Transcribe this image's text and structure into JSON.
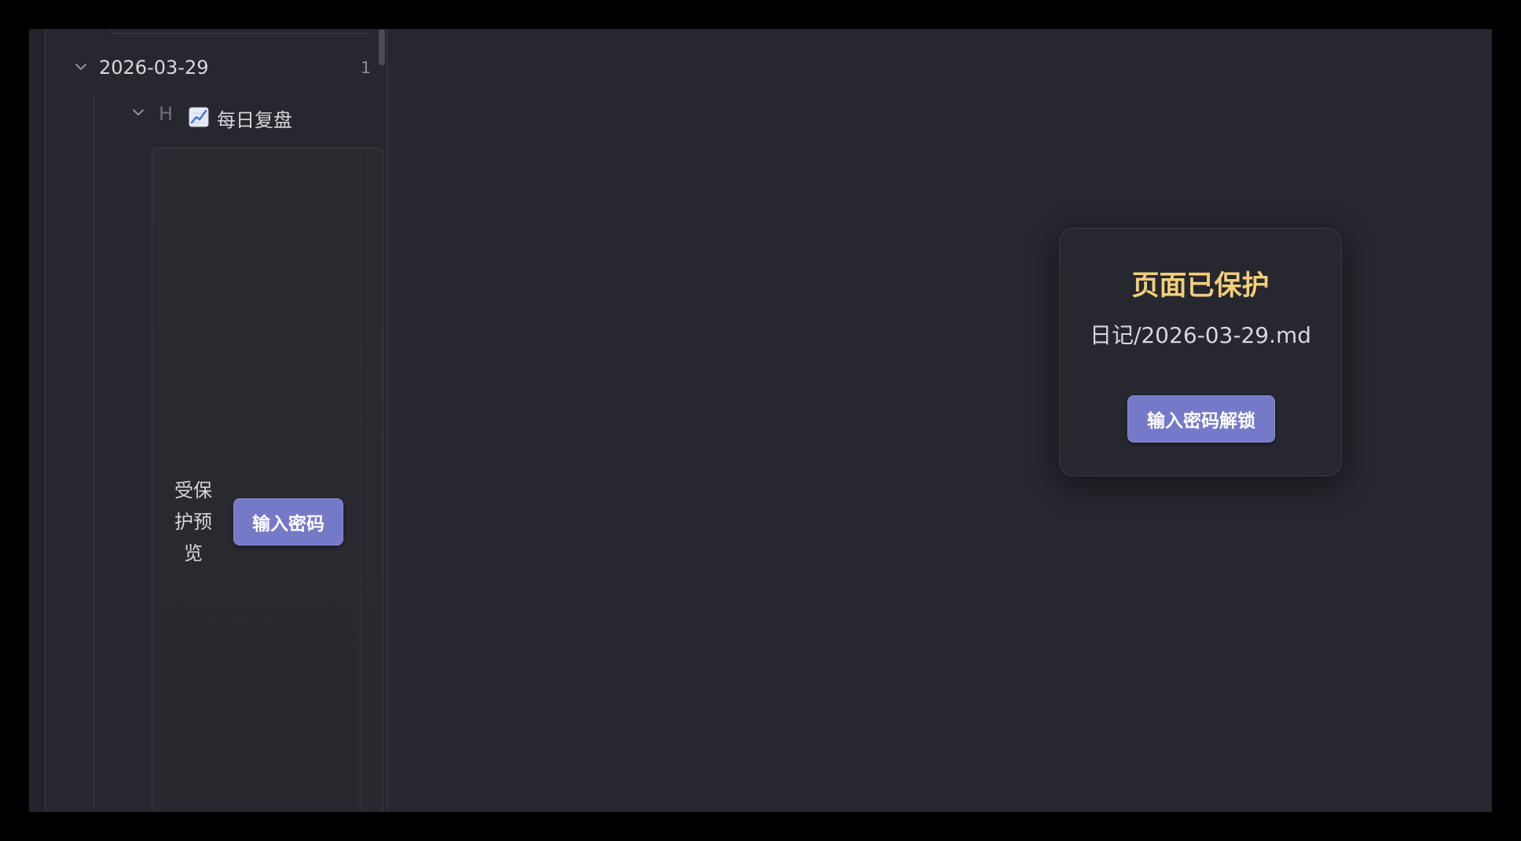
{
  "sidebar": {
    "date_group": {
      "label": "2026-03-29",
      "count": "1",
      "icon": "chevron-down-icon"
    },
    "heading": {
      "marker": "H",
      "emoji_icon": "chart-increasing-icon",
      "label": "每日复盘",
      "icon": "chevron-down-icon"
    },
    "preview": {
      "text": "受保护预览",
      "button_label": "输入密码"
    }
  },
  "lock_dialog": {
    "title": "页面已保护",
    "path": "日记/2026-03-29.md",
    "button_label": "输入密码解锁"
  },
  "colors": {
    "accent_button": "#7479c8",
    "title_gold": "#f2cf78",
    "background": "#26272f"
  }
}
